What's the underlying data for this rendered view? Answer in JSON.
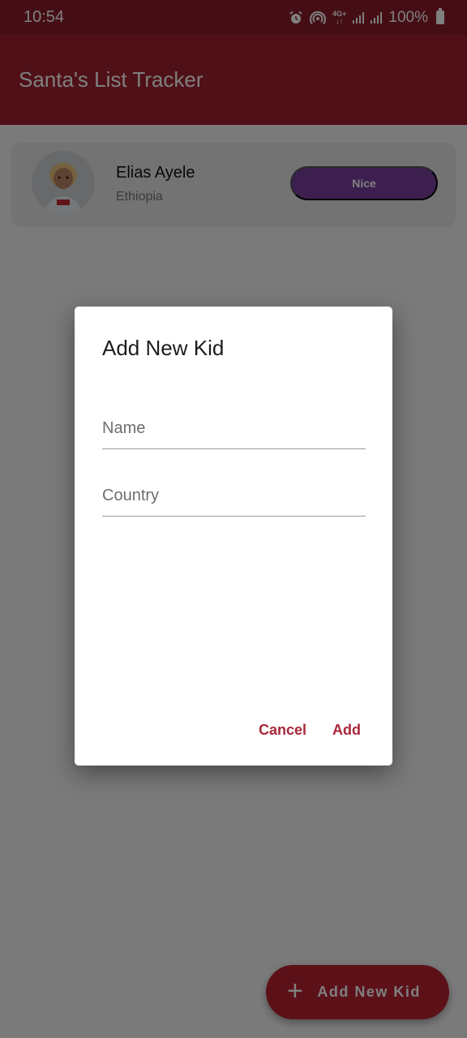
{
  "status_bar": {
    "time": "10:54",
    "network_label_top": "4G+",
    "network_label_bottom": "↓↑",
    "battery_text": "100%",
    "icons": [
      "alarm-icon",
      "hotspot-icon",
      "network-4g-icon",
      "signal-icon",
      "signal-icon",
      "battery-icon"
    ]
  },
  "app_bar": {
    "title": "Santa's List Tracker"
  },
  "kids": [
    {
      "name": "Elias Ayele",
      "country": "Ethiopia",
      "status_label": "Nice",
      "status_color": "#7b3f9e"
    }
  ],
  "fab": {
    "icon": "plus-icon",
    "label": "Add New Kid"
  },
  "dialog": {
    "title": "Add New Kid",
    "fields": {
      "name": {
        "value": "",
        "placeholder": "Name"
      },
      "country": {
        "value": "",
        "placeholder": "Country"
      }
    },
    "actions": {
      "cancel_label": "Cancel",
      "add_label": "Add"
    }
  },
  "colors": {
    "primary": "#a1202e",
    "status_bar": "#8a1c2a",
    "accent_text": "#a8283a",
    "nice": "#7b3f9e"
  }
}
